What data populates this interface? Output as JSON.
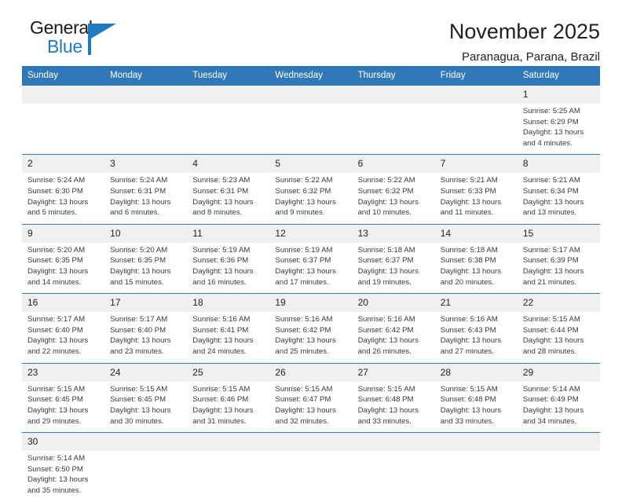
{
  "brand": {
    "name_part1": "General",
    "name_part2": "Blue"
  },
  "header": {
    "title": "November 2025",
    "subtitle": "Paranagua, Parana, Brazil"
  },
  "weekdays": [
    "Sunday",
    "Monday",
    "Tuesday",
    "Wednesday",
    "Thursday",
    "Friday",
    "Saturday"
  ],
  "colors": {
    "header_blue": "#3178b8",
    "daynum_band": "#f0f0f0",
    "logo_blue": "#1f7ac0",
    "text": "#231f20"
  },
  "labels": {
    "sunrise_prefix": "Sunrise:",
    "sunset_prefix": "Sunset:",
    "daylight_prefix": "Daylight:"
  },
  "weeks": [
    {
      "days": [
        {
          "num": "",
          "lines": []
        },
        {
          "num": "",
          "lines": []
        },
        {
          "num": "",
          "lines": []
        },
        {
          "num": "",
          "lines": []
        },
        {
          "num": "",
          "lines": []
        },
        {
          "num": "",
          "lines": []
        },
        {
          "num": "1",
          "lines": [
            "Sunrise: 5:25 AM",
            "Sunset: 6:29 PM",
            "Daylight: 13 hours",
            "and 4 minutes."
          ]
        }
      ]
    },
    {
      "days": [
        {
          "num": "2",
          "lines": [
            "Sunrise: 5:24 AM",
            "Sunset: 6:30 PM",
            "Daylight: 13 hours",
            "and 5 minutes."
          ]
        },
        {
          "num": "3",
          "lines": [
            "Sunrise: 5:24 AM",
            "Sunset: 6:31 PM",
            "Daylight: 13 hours",
            "and 6 minutes."
          ]
        },
        {
          "num": "4",
          "lines": [
            "Sunrise: 5:23 AM",
            "Sunset: 6:31 PM",
            "Daylight: 13 hours",
            "and 8 minutes."
          ]
        },
        {
          "num": "5",
          "lines": [
            "Sunrise: 5:22 AM",
            "Sunset: 6:32 PM",
            "Daylight: 13 hours",
            "and 9 minutes."
          ]
        },
        {
          "num": "6",
          "lines": [
            "Sunrise: 5:22 AM",
            "Sunset: 6:32 PM",
            "Daylight: 13 hours",
            "and 10 minutes."
          ]
        },
        {
          "num": "7",
          "lines": [
            "Sunrise: 5:21 AM",
            "Sunset: 6:33 PM",
            "Daylight: 13 hours",
            "and 11 minutes."
          ]
        },
        {
          "num": "8",
          "lines": [
            "Sunrise: 5:21 AM",
            "Sunset: 6:34 PM",
            "Daylight: 13 hours",
            "and 13 minutes."
          ]
        }
      ]
    },
    {
      "days": [
        {
          "num": "9",
          "lines": [
            "Sunrise: 5:20 AM",
            "Sunset: 6:35 PM",
            "Daylight: 13 hours",
            "and 14 minutes."
          ]
        },
        {
          "num": "10",
          "lines": [
            "Sunrise: 5:20 AM",
            "Sunset: 6:35 PM",
            "Daylight: 13 hours",
            "and 15 minutes."
          ]
        },
        {
          "num": "11",
          "lines": [
            "Sunrise: 5:19 AM",
            "Sunset: 6:36 PM",
            "Daylight: 13 hours",
            "and 16 minutes."
          ]
        },
        {
          "num": "12",
          "lines": [
            "Sunrise: 5:19 AM",
            "Sunset: 6:37 PM",
            "Daylight: 13 hours",
            "and 17 minutes."
          ]
        },
        {
          "num": "13",
          "lines": [
            "Sunrise: 5:18 AM",
            "Sunset: 6:37 PM",
            "Daylight: 13 hours",
            "and 19 minutes."
          ]
        },
        {
          "num": "14",
          "lines": [
            "Sunrise: 5:18 AM",
            "Sunset: 6:38 PM",
            "Daylight: 13 hours",
            "and 20 minutes."
          ]
        },
        {
          "num": "15",
          "lines": [
            "Sunrise: 5:17 AM",
            "Sunset: 6:39 PM",
            "Daylight: 13 hours",
            "and 21 minutes."
          ]
        }
      ]
    },
    {
      "days": [
        {
          "num": "16",
          "lines": [
            "Sunrise: 5:17 AM",
            "Sunset: 6:40 PM",
            "Daylight: 13 hours",
            "and 22 minutes."
          ]
        },
        {
          "num": "17",
          "lines": [
            "Sunrise: 5:17 AM",
            "Sunset: 6:40 PM",
            "Daylight: 13 hours",
            "and 23 minutes."
          ]
        },
        {
          "num": "18",
          "lines": [
            "Sunrise: 5:16 AM",
            "Sunset: 6:41 PM",
            "Daylight: 13 hours",
            "and 24 minutes."
          ]
        },
        {
          "num": "19",
          "lines": [
            "Sunrise: 5:16 AM",
            "Sunset: 6:42 PM",
            "Daylight: 13 hours",
            "and 25 minutes."
          ]
        },
        {
          "num": "20",
          "lines": [
            "Sunrise: 5:16 AM",
            "Sunset: 6:42 PM",
            "Daylight: 13 hours",
            "and 26 minutes."
          ]
        },
        {
          "num": "21",
          "lines": [
            "Sunrise: 5:16 AM",
            "Sunset: 6:43 PM",
            "Daylight: 13 hours",
            "and 27 minutes."
          ]
        },
        {
          "num": "22",
          "lines": [
            "Sunrise: 5:15 AM",
            "Sunset: 6:44 PM",
            "Daylight: 13 hours",
            "and 28 minutes."
          ]
        }
      ]
    },
    {
      "days": [
        {
          "num": "23",
          "lines": [
            "Sunrise: 5:15 AM",
            "Sunset: 6:45 PM",
            "Daylight: 13 hours",
            "and 29 minutes."
          ]
        },
        {
          "num": "24",
          "lines": [
            "Sunrise: 5:15 AM",
            "Sunset: 6:45 PM",
            "Daylight: 13 hours",
            "and 30 minutes."
          ]
        },
        {
          "num": "25",
          "lines": [
            "Sunrise: 5:15 AM",
            "Sunset: 6:46 PM",
            "Daylight: 13 hours",
            "and 31 minutes."
          ]
        },
        {
          "num": "26",
          "lines": [
            "Sunrise: 5:15 AM",
            "Sunset: 6:47 PM",
            "Daylight: 13 hours",
            "and 32 minutes."
          ]
        },
        {
          "num": "27",
          "lines": [
            "Sunrise: 5:15 AM",
            "Sunset: 6:48 PM",
            "Daylight: 13 hours",
            "and 33 minutes."
          ]
        },
        {
          "num": "28",
          "lines": [
            "Sunrise: 5:15 AM",
            "Sunset: 6:48 PM",
            "Daylight: 13 hours",
            "and 33 minutes."
          ]
        },
        {
          "num": "29",
          "lines": [
            "Sunrise: 5:14 AM",
            "Sunset: 6:49 PM",
            "Daylight: 13 hours",
            "and 34 minutes."
          ]
        }
      ]
    },
    {
      "days": [
        {
          "num": "30",
          "lines": [
            "Sunrise: 5:14 AM",
            "Sunset: 6:50 PM",
            "Daylight: 13 hours",
            "and 35 minutes."
          ]
        },
        {
          "num": "",
          "lines": []
        },
        {
          "num": "",
          "lines": []
        },
        {
          "num": "",
          "lines": []
        },
        {
          "num": "",
          "lines": []
        },
        {
          "num": "",
          "lines": []
        },
        {
          "num": "",
          "lines": []
        }
      ]
    }
  ]
}
